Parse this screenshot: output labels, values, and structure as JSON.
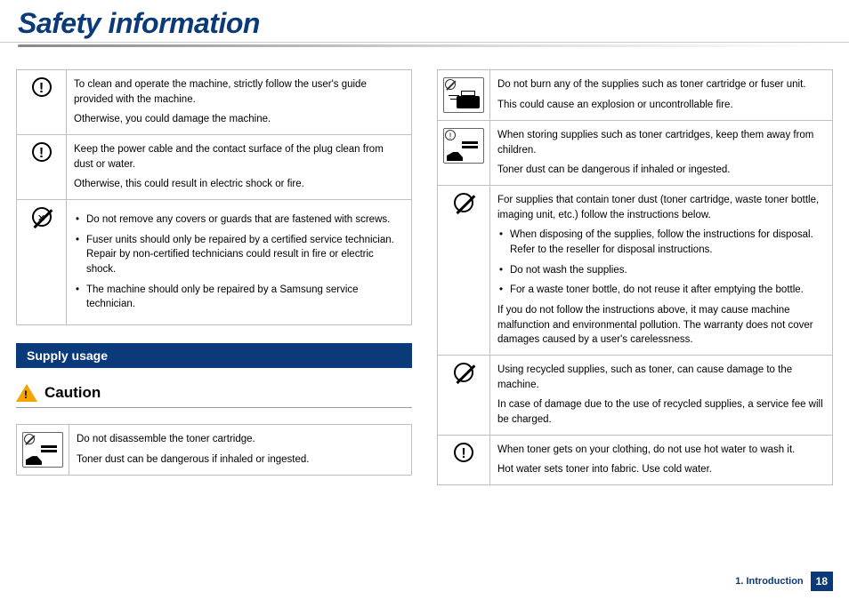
{
  "page_title": "Safety information",
  "left": {
    "rows": [
      {
        "icon": "circle-exclamation",
        "p1": "To clean and operate the machine, strictly follow the user's guide provided with the machine.",
        "p2": "Otherwise, you could damage the machine."
      },
      {
        "icon": "circle-exclamation",
        "p1": "Keep the power cable and the contact surface of the plug clean from dust or water.",
        "p2": "Otherwise, this could result in electric shock or fire."
      },
      {
        "icon": "circle-slash-x",
        "bullets": [
          "Do not remove any covers or guards that are fastened with screws.",
          "Fuser units should only be repaired by a certified service technician. Repair by non-certified technicians could result in fire or electric shock.",
          "The machine should only be repaired by a Samsung service technician."
        ]
      }
    ],
    "section": "Supply usage",
    "caution_label": "Caution",
    "caution_row": {
      "icon": "pict-disassemble",
      "p1": "Do not disassemble the toner cartridge.",
      "p2": "Toner dust can be dangerous if inhaled or ingested."
    }
  },
  "right": {
    "rows": [
      {
        "icon": "pict-burn",
        "p1": "Do not burn any of the supplies such as toner cartridge or fuser unit.",
        "p2": "This could cause an explosion or uncontrollable fire."
      },
      {
        "icon": "pict-children",
        "p1": "When storing supplies such as toner cartridges, keep them away from children.",
        "p2": "Toner dust can be dangerous if inhaled or ingested."
      },
      {
        "icon": "circle-slash",
        "p0": "For supplies that contain toner dust (toner cartridge, waste toner bottle, imaging unit, etc.) follow the instructions below.",
        "bullets": [
          "When disposing of the supplies, follow the instructions for disposal. Refer to the reseller for disposal instructions.",
          "Do not wash the supplies.",
          "For a waste toner bottle, do not reuse it after emptying the bottle."
        ],
        "p_after": "If you do not follow the instructions above, it may cause machine malfunction and environmental pollution. The warranty does not cover damages caused by a user's carelessness."
      },
      {
        "icon": "circle-slash",
        "p1": "Using recycled supplies, such as toner, can cause damage to the machine.",
        "p2": "In case of damage due to the use of recycled supplies, a service fee will be charged."
      },
      {
        "icon": "circle-exclamation",
        "p1": "When toner gets on your clothing, do not use hot water to wash it.",
        "p2": "Hot water sets toner into fabric. Use cold water."
      }
    ]
  },
  "footer": {
    "chapter": "1. Introduction",
    "page": "18"
  }
}
